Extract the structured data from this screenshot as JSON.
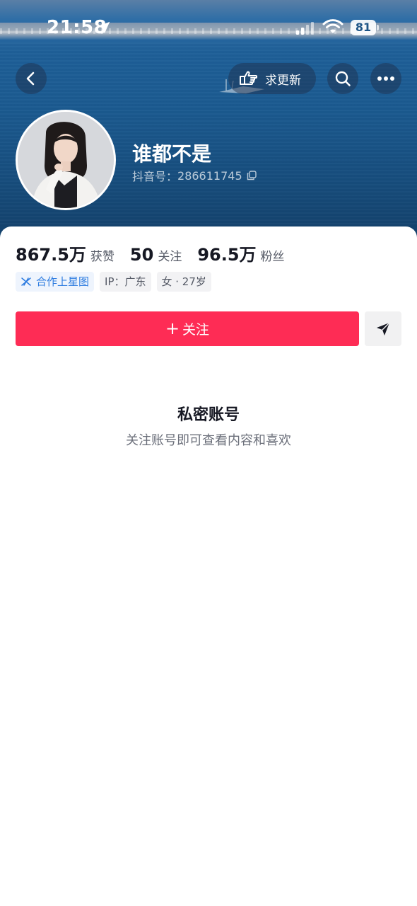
{
  "status_bar": {
    "time": "21:58",
    "battery": "81",
    "icons": [
      "location-arrow-icon",
      "signal-icon",
      "wifi-icon",
      "battery-icon"
    ]
  },
  "nav": {
    "back_icon": "chevron-left-icon",
    "update_label": "求更新",
    "update_icon": "pointing-hand-icon",
    "search_icon": "search-icon",
    "more_icon": "more-dots-icon"
  },
  "profile": {
    "name": "谁都不是",
    "id_label": "抖音号：",
    "id_value": "286611745"
  },
  "stats": [
    {
      "value": "867.5万",
      "label": "获赞"
    },
    {
      "value": "50",
      "label": "关注"
    },
    {
      "value": "96.5万",
      "label": "粉丝"
    }
  ],
  "tags": {
    "partner": "合作上星图",
    "ip": "IP：广东",
    "gender_age": "女 · 27岁"
  },
  "actions": {
    "follow_plus": "+",
    "follow_label": "关注",
    "share_icon": "send-icon"
  },
  "private": {
    "title": "私密账号",
    "subtitle": "关注账号即可查看内容和喜欢"
  },
  "colors": {
    "follow_button": "#fe2c55",
    "partner_tag": "#2c7be0",
    "banner_sea": "#1b5a90"
  }
}
